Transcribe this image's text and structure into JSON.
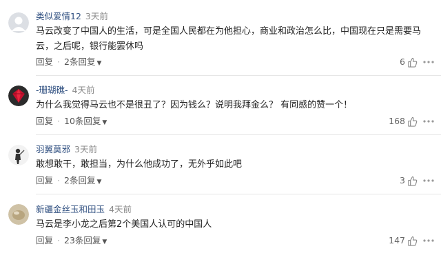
{
  "comments": [
    {
      "username": "类似爱情12",
      "time": "3天前",
      "text": "马云改变了中国人的生活，可是全国人民都在为他担心，商业和政治怎么比，中国现在只是需要马云，之后呢，银行能罢休吗",
      "reply_label": "回复",
      "replies_label": "2条回复",
      "likes": "6",
      "avatar": "default-avatar"
    },
    {
      "username": "-珊瑚礁-",
      "time": "4天前",
      "text": "为什么我觉得马云也不是很丑了？因为钱么？说明我拜金么？ 有同感的赞一个！",
      "reply_label": "回复",
      "replies_label": "10条回复",
      "likes": "168",
      "avatar": "red-gem-avatar"
    },
    {
      "username": "羽翼莫邪",
      "time": "3天前",
      "text": "敢想敢干，敢担当，为什么他成功了，无外乎如此吧",
      "reply_label": "回复",
      "replies_label": "2条回复",
      "likes": "3",
      "avatar": "figure-avatar"
    },
    {
      "username": "新疆金丝玉和田玉",
      "time": "4天前",
      "text": "马云是李小龙之后第2个美国人认可的中国人",
      "reply_label": "回复",
      "replies_label": "23条回复",
      "likes": "147",
      "avatar": "stone-avatar"
    }
  ],
  "colors": {
    "username": "#2f4f80",
    "time": "#8a8a8a",
    "text": "#222222",
    "divider": "#e6e6e6"
  }
}
